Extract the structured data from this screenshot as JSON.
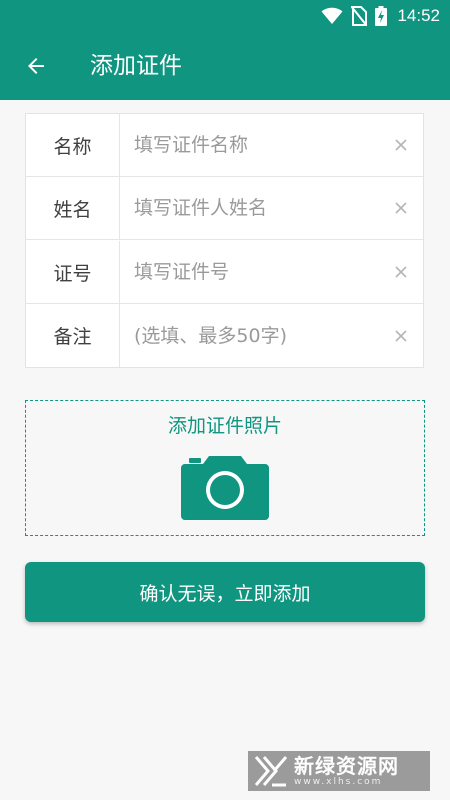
{
  "status_bar": {
    "time": "14:52",
    "icons": [
      "wifi-icon",
      "no-sim-icon",
      "battery-charging-icon"
    ]
  },
  "app_bar": {
    "back_icon": "arrow-left-icon",
    "title": "添加证件"
  },
  "form": {
    "rows": [
      {
        "label": "名称",
        "value": "",
        "placeholder": "填写证件名称",
        "clear_icon": "clear-icon"
      },
      {
        "label": "姓名",
        "value": "",
        "placeholder": "填写证件人姓名",
        "clear_icon": "clear-icon"
      },
      {
        "label": "证号",
        "value": "",
        "placeholder": "填写证件号",
        "clear_icon": "clear-icon"
      },
      {
        "label": "备注",
        "value": "",
        "placeholder": "(选填、最多50字)",
        "clear_icon": "clear-icon"
      }
    ]
  },
  "photo": {
    "label": "添加证件照片",
    "icon": "camera-icon"
  },
  "submit": {
    "label": "确认无误，立即添加"
  },
  "watermark": {
    "name_cn": "新绿资源网",
    "url": "www.xlhs.com"
  },
  "colors": {
    "primary": "#0f9580",
    "background": "#f7f7f7",
    "watermark_bg": "#8b8b8b"
  }
}
